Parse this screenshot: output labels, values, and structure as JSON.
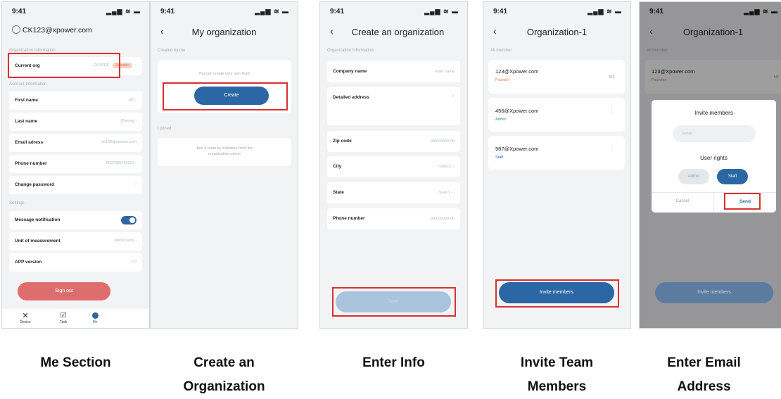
{
  "status_time": "9:41",
  "status_icons": "▂▄▆ ≋ ▬",
  "screen1": {
    "account": "CK123@xpower.com",
    "section_org": "Organization Information",
    "current_org_label": "Current org",
    "current_org_value": "CKXPRE",
    "founder_badge": "Founder",
    "section_account": "Account Information",
    "rows": [
      {
        "label": "First name",
        "value": "Jan"
      },
      {
        "label": "Last name",
        "value": "Cheung"
      },
      {
        "label": "Email adress",
        "value": "ck123@xpower.com"
      },
      {
        "label": "Phone number",
        "value": "6037565246623"
      },
      {
        "label": "Change password",
        "value": ""
      }
    ],
    "section_settings": "Settings",
    "message_notification": "Message notification",
    "unit_label": "Unit of measurement",
    "unit_value": "Metric units",
    "app_version_label": "APP version",
    "app_version_value": "1.0",
    "sign_out": "Sign out",
    "nav": [
      {
        "label": "Device"
      },
      {
        "label": "Task"
      },
      {
        "label": "Me"
      }
    ]
  },
  "screen2": {
    "title": "My organization",
    "created_by_me": "Created by me",
    "create_hint": "You can create your own team",
    "create_button": "Create",
    "i_joined": "I joined",
    "join_hint_1": "Join a team by invitation from the",
    "join_hint_2": "organization owner"
  },
  "screen3": {
    "title": "Create an organization",
    "section": "Organization Information",
    "company_label": "Company name",
    "company_placeholder": "enter name",
    "address_label": "Detailed address",
    "zip_label": "Zip code",
    "zip_placeholder": "000-00000-00",
    "city_label": "City",
    "city_placeholder": "- Select -",
    "state_label": "State",
    "state_placeholder": "- Select -",
    "phone_label": "Phone number",
    "phone_placeholder": "000-00000-00",
    "save_button": "Save"
  },
  "screen4": {
    "title": "Organization-1",
    "section": "All member",
    "members": [
      {
        "email": "123@Xpower.com",
        "role": "Founder",
        "tag": "ME"
      },
      {
        "email": "456@Xpower.com",
        "role": "Admin",
        "tag": ""
      },
      {
        "email": "987@Xpower.com",
        "role": "Staff",
        "tag": ""
      }
    ],
    "invite_button": "Invite members"
  },
  "screen5": {
    "title": "Organization-1",
    "section": "All member",
    "member_email": "123@Xpower.com",
    "member_role": "Founder",
    "member_tag": "ME",
    "dialog_title": "Invite members",
    "email_placeholder": "Email",
    "user_rights": "User rights",
    "admin": "Admin",
    "staff": "Staff",
    "cancel": "Cancel",
    "send": "Send",
    "invite_button": "Invite members"
  },
  "captions": {
    "c1": "Me Section",
    "c2a": "Create an",
    "c2b": "Organization",
    "c3": "Enter Info",
    "c4a": "Invite Team",
    "c4b": "Members",
    "c5a": "Enter Email",
    "c5b": "Address"
  }
}
